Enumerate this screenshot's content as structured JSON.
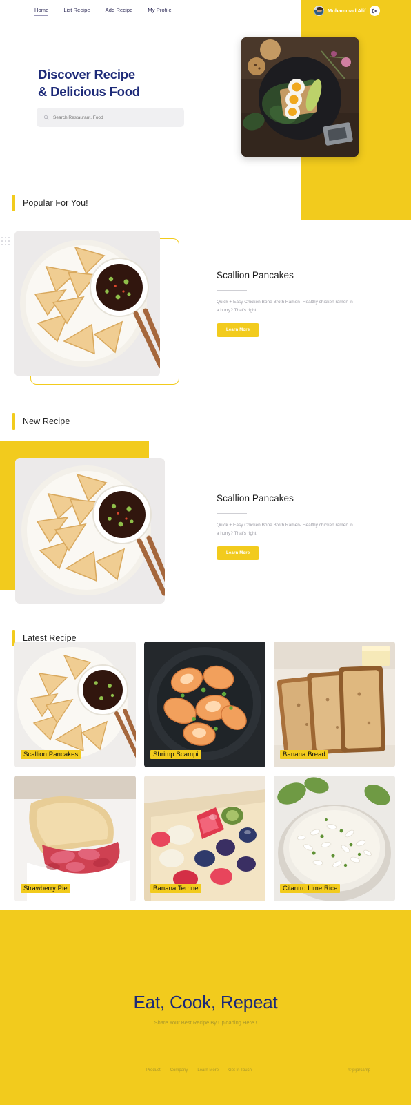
{
  "nav": {
    "items": [
      {
        "label": "Home",
        "active": true
      },
      {
        "label": "List Recipe",
        "active": false
      },
      {
        "label": "Add Recipe",
        "active": false
      },
      {
        "label": "My Profile",
        "active": false
      }
    ]
  },
  "user": {
    "name": "Muhammad Alif",
    "logout_icon": "logout-icon",
    "avatar_icon": "user-avatar"
  },
  "hero": {
    "title_line1": "Discover Recipe",
    "title_line2": "& Delicious Food",
    "title_color": "#1d2a78",
    "search_placeholder": "Search Restaurant, Food",
    "search_value": "",
    "search_icon": "search-icon",
    "image_alt": "egg-avocado-toast-plate"
  },
  "theme": {
    "accent": "#f2cb1d",
    "navy": "#1d2a78",
    "muted": "#9b9ba4"
  },
  "sections": [
    {
      "id": "popular",
      "title": "Popular For You!"
    },
    {
      "id": "new",
      "title": "New Recipe"
    },
    {
      "id": "latest",
      "title": "Latest Recipe"
    }
  ],
  "popular": {
    "title": "Scallion Pancakes",
    "description": "Quick + Easy Chicken Bone Broth Ramen- Healthy chicken ramen in a hurry? That's right!",
    "button": "Learn More",
    "image_alt": "scallion-pancakes-plate"
  },
  "new_recipe": {
    "title": "Scallion Pancakes",
    "description": "Quick + Easy Chicken Bone Broth Ramen- Healthy chicken ramen in a hurry? That's right!",
    "button": "Learn More",
    "image_alt": "scallion-pancakes-plate"
  },
  "latest": {
    "tiles": [
      {
        "label": "Scallion Pancakes",
        "art": "pancakes"
      },
      {
        "label": "Shrimp Scampi",
        "art": "shrimp"
      },
      {
        "label": "Banana Bread",
        "art": "bread"
      },
      {
        "label": "Strawberry Pie",
        "art": "pie"
      },
      {
        "label": "Banana Terrine",
        "art": "terrine"
      },
      {
        "label": "Cilantro Lime Rice",
        "art": "rice"
      }
    ]
  },
  "footer": {
    "title": "Eat, Cook, Repeat",
    "subtitle": "Share Your Best Recipe By Uploading Here !",
    "links": [
      "Product",
      "Company",
      "Learn More",
      "Get In Touch"
    ],
    "copyright": "© pijarcamp"
  }
}
